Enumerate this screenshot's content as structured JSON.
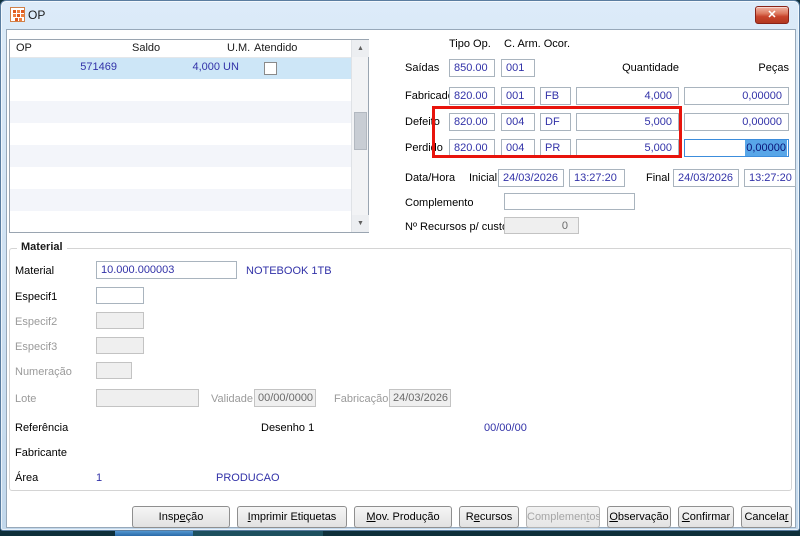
{
  "window": {
    "title": "OP",
    "close_glyph": "✕"
  },
  "colors": {
    "value_text": "#3232a8",
    "annotation_red": "#e8140c",
    "selection_bg": "#58a6e8",
    "selected_row_bg": "#cde6f7"
  },
  "op_list": {
    "headers": {
      "op": "OP",
      "saldo": "Saldo",
      "um": "U.M.",
      "atendido": "Atendido"
    },
    "row": {
      "op": "571469",
      "saldo": "4,000",
      "um": "UN",
      "atendido_checked": false
    },
    "scroll_up": "▲",
    "scroll_down": "▼"
  },
  "ops": {
    "header_tipo": "Tipo Op.",
    "header_carm_ocor": "C. Arm. Ocor.",
    "header_qtd": "Quantidade",
    "header_pecas": "Peças",
    "saidas": {
      "label": "Saídas",
      "tipo": "850.00",
      "carm": "001"
    },
    "fabricado": {
      "label": "Fabricado",
      "tipo": "820.00",
      "carm": "001",
      "ocor": "FB",
      "qtd": "4,000",
      "pecas": "0,00000"
    },
    "defeito": {
      "label": "Defeito",
      "tipo": "820.00",
      "carm": "004",
      "ocor": "DF",
      "qtd": "5,000",
      "pecas": "0,00000"
    },
    "perdido": {
      "label": "Perdido",
      "tipo": "820.00",
      "carm": "004",
      "ocor": "PR",
      "qtd": "5,000",
      "pecas": "0,00000"
    }
  },
  "datahora": {
    "label": "Data/Hora",
    "inicial_label": "Inicial",
    "inicial_date": "24/03/2026",
    "inicial_time": "13:27:20",
    "final_label": "Final",
    "final_date": "24/03/2026",
    "final_time": "13:27:20"
  },
  "complemento": {
    "label": "Complemento",
    "value": ""
  },
  "recursos_custos": {
    "label": "Nº Recursos p/ custos",
    "value": "0"
  },
  "material": {
    "group_label": "Material",
    "material_label": "Material",
    "material_code": "10.000.000003",
    "material_desc": "NOTEBOOK 1TB",
    "especif1_label": "Especif1",
    "especif1_value": "",
    "especif2_label": "Especif2",
    "especif2_value": "",
    "especif3_label": "Especif3",
    "especif3_value": "",
    "numeracao_label": "Numeração",
    "numeracao_value": "",
    "lote_label": "Lote",
    "lote_value": "",
    "validade_label": "Validade",
    "validade_value": "00/00/0000",
    "fabricacao_label": "Fabricação",
    "fabricacao_value": "24/03/2026",
    "referencia_label": "Referência",
    "desenho_label": "Desenho 1",
    "referencia_date": "00/00/00",
    "fabricante_label": "Fabricante",
    "area_label": "Área",
    "area_code": "1",
    "area_desc": "PRODUCAO"
  },
  "buttons": [
    {
      "pre": "Insp",
      "key": "e",
      "post": "ção",
      "enabled": true
    },
    {
      "pre": "",
      "key": "I",
      "post": "mprimir Etiquetas",
      "enabled": true
    },
    {
      "pre": "",
      "key": "M",
      "post": "ov. Produção",
      "enabled": true
    },
    {
      "pre": "R",
      "key": "e",
      "post": "cursos",
      "enabled": true
    },
    {
      "pre": "Complemen",
      "key": "t",
      "post": "os",
      "enabled": false
    },
    {
      "pre": "",
      "key": "O",
      "post": "bservação",
      "enabled": true
    },
    {
      "pre": "",
      "key": "C",
      "post": "onfirmar",
      "enabled": true
    },
    {
      "pre": "Cancela",
      "key": "r",
      "post": "",
      "enabled": true
    }
  ]
}
